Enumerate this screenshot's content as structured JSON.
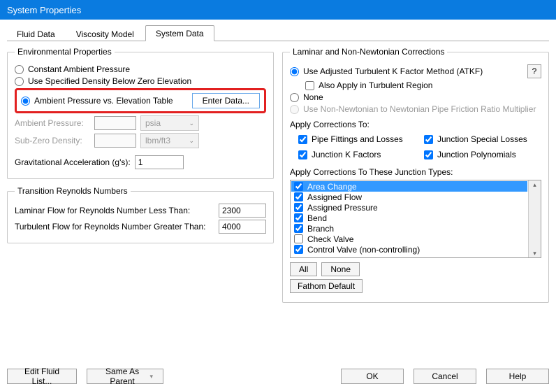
{
  "window": {
    "title": "System Properties"
  },
  "tabs": {
    "fluid": "Fluid Data",
    "viscosity": "Viscosity Model",
    "system": "System Data"
  },
  "env": {
    "legend": "Environmental Properties",
    "opt_const": "Constant Ambient Pressure",
    "opt_density": "Use Specified Density Below Zero Elevation",
    "opt_table": "Ambient Pressure vs. Elevation Table",
    "enter_data": "Enter Data...",
    "ambient_pressure": "Ambient Pressure:",
    "unit_pressure": "psia",
    "subzero": "Sub-Zero Density:",
    "unit_density": "lbm/ft3",
    "grav": "Gravitational Acceleration (g's):",
    "grav_val": "1"
  },
  "reynolds": {
    "legend": "Transition Reynolds Numbers",
    "laminar": "Laminar Flow for Reynolds Number Less Than:",
    "laminar_val": "2300",
    "turbulent": "Turbulent Flow for Reynolds Number Greater Than:",
    "turbulent_val": "4000"
  },
  "laminar": {
    "legend": "Laminar and Non-Newtonian Corrections",
    "atkf": "Use Adjusted Turbulent K Factor Method (ATKF)",
    "help": "?",
    "also_turb": "Also Apply in Turbulent Region",
    "none": "None",
    "nn_ratio": "Use Non-Newtonian to Newtonian Pipe Friction Ratio Multiplier",
    "apply_to": "Apply Corrections To:",
    "chk1": "Pipe Fittings and Losses",
    "chk2": "Junction Special Losses",
    "chk3": "Junction K Factors",
    "chk4": "Junction Polynomials",
    "junction_types": "Apply Corrections To These Junction Types:",
    "items": [
      {
        "label": "Area Change",
        "checked": true,
        "selected": true
      },
      {
        "label": "Assigned Flow",
        "checked": true,
        "selected": false
      },
      {
        "label": "Assigned Pressure",
        "checked": true,
        "selected": false
      },
      {
        "label": "Bend",
        "checked": true,
        "selected": false
      },
      {
        "label": "Branch",
        "checked": true,
        "selected": false
      },
      {
        "label": "Check Valve",
        "checked": false,
        "selected": false
      },
      {
        "label": "Control Valve (non-controlling)",
        "checked": true,
        "selected": false
      }
    ],
    "all": "All",
    "none_btn": "None",
    "fathom": "Fathom Default"
  },
  "footer": {
    "edit_fluid": "Edit Fluid List...",
    "same_as": "Same As Parent",
    "ok": "OK",
    "cancel": "Cancel",
    "help": "Help"
  }
}
